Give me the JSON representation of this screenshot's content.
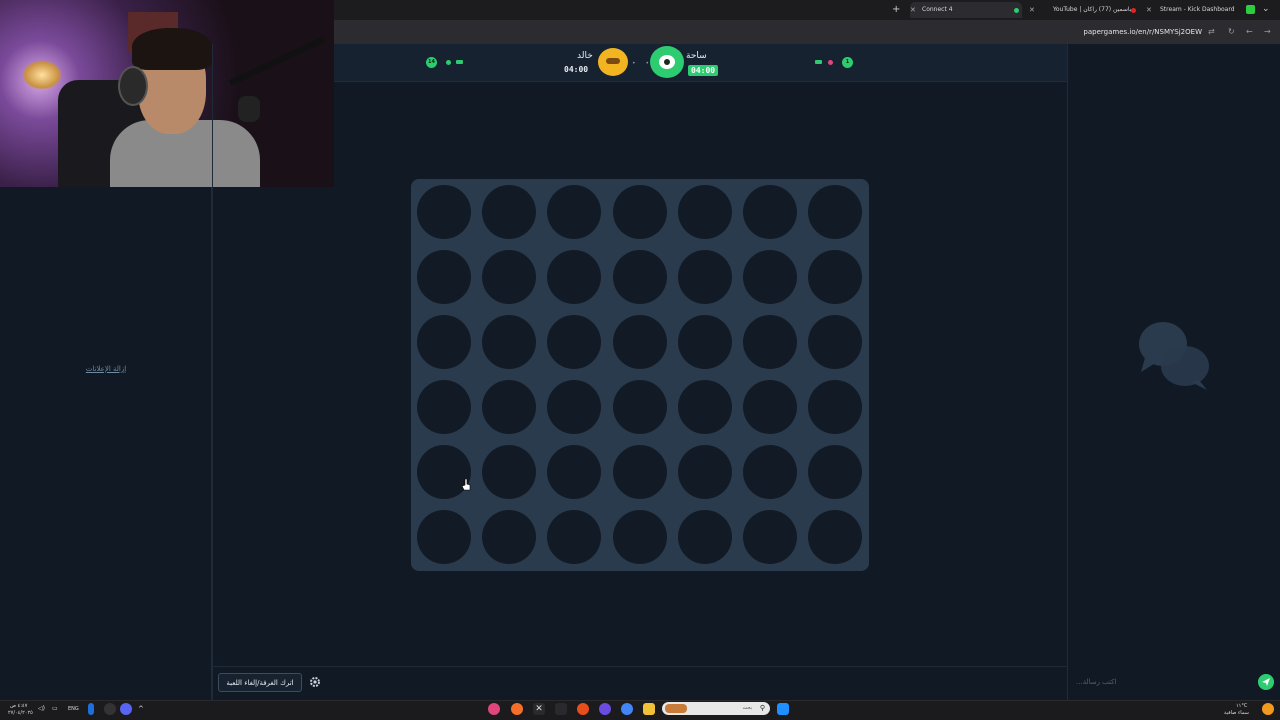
{
  "browser": {
    "tabs": [
      {
        "label": "Connect 4",
        "active": true
      },
      {
        "label": "YouTube | باسمين (77) راكان",
        "active": false
      },
      {
        "label": "Stream - Kick Dashboard",
        "active": false
      }
    ],
    "url": "papergames.io/en/r/NSMYSj2OEW"
  },
  "game": {
    "score_left": "14",
    "score_right": "1",
    "player1": {
      "name": "خالد",
      "time": "04:00"
    },
    "player2": {
      "name": "ساحة",
      "time": "04:00"
    },
    "board": {
      "columns": 7,
      "rows": 6,
      "filled_cells": 0
    }
  },
  "sidebar": {
    "ads_link": "إزالة الإعلانات"
  },
  "actions": {
    "leave_label": "اترك الغرفة/إلغاء اللعبة"
  },
  "chat": {
    "placeholder": "...اكتب رسالة"
  },
  "taskbar": {
    "time": "٤:٤٧ ص",
    "date": "٢٧/٠٤/٢٠٢٥",
    "lang": "ENG",
    "search_placeholder": "بحث",
    "weather_temp": "١١°C",
    "weather_text": "سماء صافية"
  },
  "colors": {
    "accent": "#2ecc71",
    "board": "#2a3b4e",
    "background": "#111a24",
    "hole": "#121b25"
  }
}
